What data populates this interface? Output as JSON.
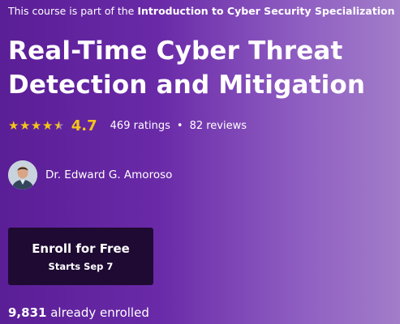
{
  "specialization": {
    "prefix": "This course is part of the",
    "name": "Introduction to Cyber Security Specialization"
  },
  "course": {
    "title": "Real-Time Cyber Threat Detection and Mitigation"
  },
  "rating": {
    "value": "4.7",
    "stars_filled": 4.5,
    "ratings_text": "469 ratings",
    "separator": "•",
    "reviews_text": "82 reviews"
  },
  "instructor": {
    "name": "Dr. Edward G. Amoroso"
  },
  "enroll": {
    "label": "Enroll for Free",
    "sub_label": "Starts Sep 7"
  },
  "enrollment": {
    "count": "9,831",
    "suffix": "already enrolled"
  },
  "colors": {
    "hero_gradient_start": "#5a1e96",
    "hero_gradient_end": "#a27dc9",
    "star": "#f5c518",
    "button_bg": "#1f0a33",
    "text": "#ffffff"
  },
  "icons": {
    "star": "star-icon",
    "avatar": "instructor-avatar"
  }
}
